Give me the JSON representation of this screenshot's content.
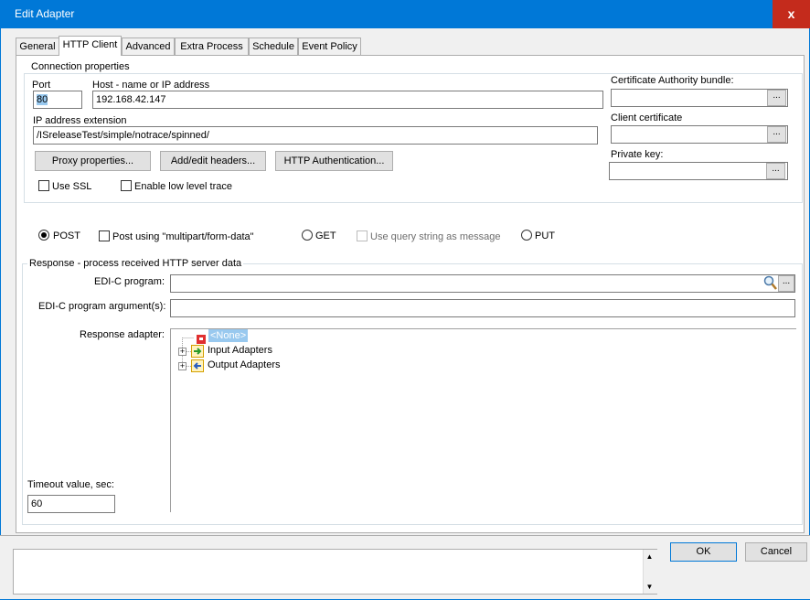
{
  "window": {
    "title": "Edit Adapter",
    "close_glyph": "x"
  },
  "tabs": [
    {
      "label": "General"
    },
    {
      "label": "HTTP Client"
    },
    {
      "label": "Advanced"
    },
    {
      "label": "Extra Process"
    },
    {
      "label": "Schedule"
    },
    {
      "label": "Event Policy"
    }
  ],
  "connection": {
    "group_label": "Connection properties",
    "port_label": "Port",
    "port_value": "80",
    "host_label": "Host - name or IP address",
    "host_value": "192.168.42.147",
    "ip_ext_label": "IP address extension",
    "ip_ext_value": "/ISreleaseTest/simple/notrace/spinned/",
    "proxy_button": "Proxy properties...",
    "headers_button": "Add/edit headers...",
    "auth_button": "HTTP Authentication...",
    "use_ssl_label": "Use SSL",
    "low_level_trace_label": "Enable low level trace",
    "ca_bundle_label": "Certificate Authority bundle:",
    "client_cert_label": "Client certificate",
    "private_key_label": "Private key:",
    "browse_glyph": "..."
  },
  "method": {
    "post_label": "POST",
    "multipart_label": "Post using \"multipart/form-data\"",
    "get_label": "GET",
    "query_string_label": "Use query string as message",
    "put_label": "PUT"
  },
  "response": {
    "group_label": "Response - process received  HTTP server data",
    "edi_program_label": "EDI-C program:",
    "edi_args_label": "EDI-C program argument(s):",
    "response_adapter_label": "Response adapter:",
    "tree": {
      "none_label": "<None>",
      "input_label": "Input Adapters",
      "output_label": "Output Adapters"
    },
    "timeout_label": "Timeout value, sec:",
    "timeout_value": "60"
  },
  "footer": {
    "ok_button": "OK",
    "cancel_button": "Cancel"
  },
  "colors": {
    "titlebar": "#0078d7",
    "close": "#c42b1c",
    "selection": "#99c9ef"
  }
}
